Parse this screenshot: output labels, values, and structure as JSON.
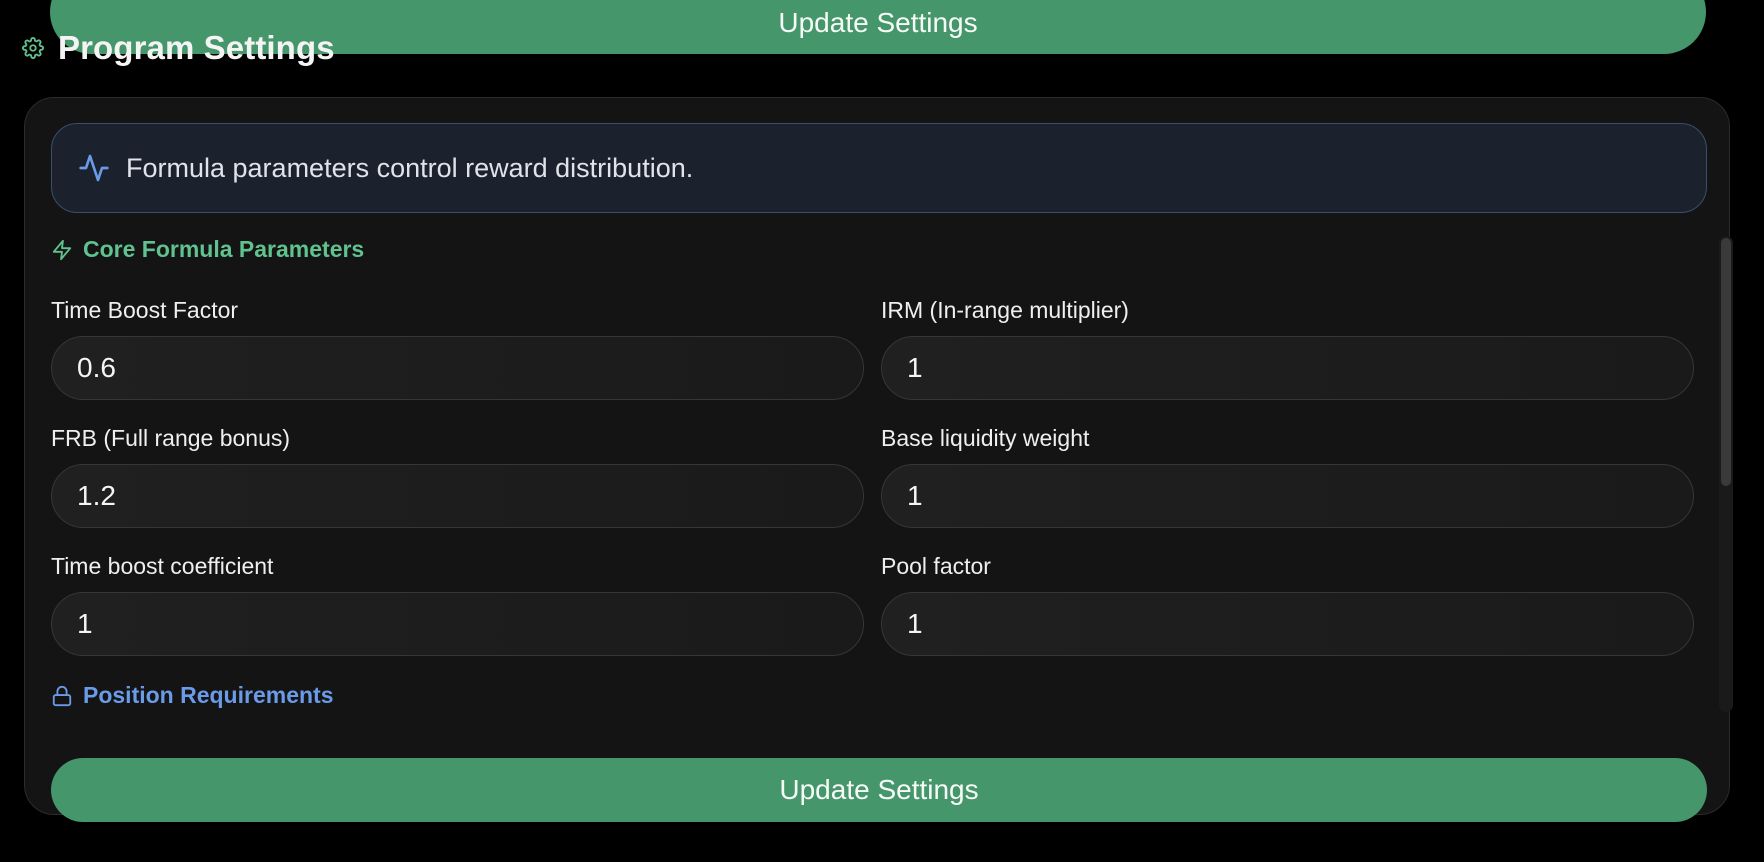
{
  "top_button": {
    "label": "Update Settings"
  },
  "header": {
    "title": "Program Settings",
    "icon": "gear-icon"
  },
  "banner": {
    "text": "Formula parameters control reward distribution.",
    "icon": "activity-icon"
  },
  "sections": {
    "core": {
      "title": "Core Formula Parameters",
      "icon": "lightning-icon"
    },
    "position": {
      "title": "Position Requirements",
      "icon": "lock-icon"
    }
  },
  "fields": [
    {
      "label": "Time Boost Factor",
      "value": "0.6"
    },
    {
      "label": "IRM (In-range multiplier)",
      "value": "1"
    },
    {
      "label": "FRB (Full range bonus)",
      "value": "1.2"
    },
    {
      "label": "Base liquidity weight",
      "value": "1"
    },
    {
      "label": "Time boost coefficient",
      "value": "1"
    },
    {
      "label": "Pool factor",
      "value": "1"
    }
  ],
  "bottom_button": {
    "label": "Update Settings"
  },
  "colors": {
    "accent_green": "#45966b",
    "section_green": "#5fc28f",
    "section_blue": "#6a9ae8",
    "banner_border": "#3a4f6e"
  }
}
